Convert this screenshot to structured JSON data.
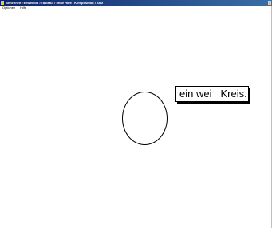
{
  "window": {
    "title": "Benennen / Einzelbild / Tastatur / ohne Hilfe / Komposition / Satz",
    "title_button_label": "?"
  },
  "menubar": {
    "items": [
      {
        "label": "Optionen"
      },
      {
        "label": "Hilfe"
      }
    ]
  },
  "canvas": {
    "picture": "circle-shape",
    "sentence": {
      "word1": "ein wei",
      "word2": "Kreis."
    }
  },
  "colors": {
    "titlebar_start": "#0a246a",
    "titlebar_end": "#3a6ea5",
    "background": "#ffffff",
    "ink": "#000000"
  }
}
